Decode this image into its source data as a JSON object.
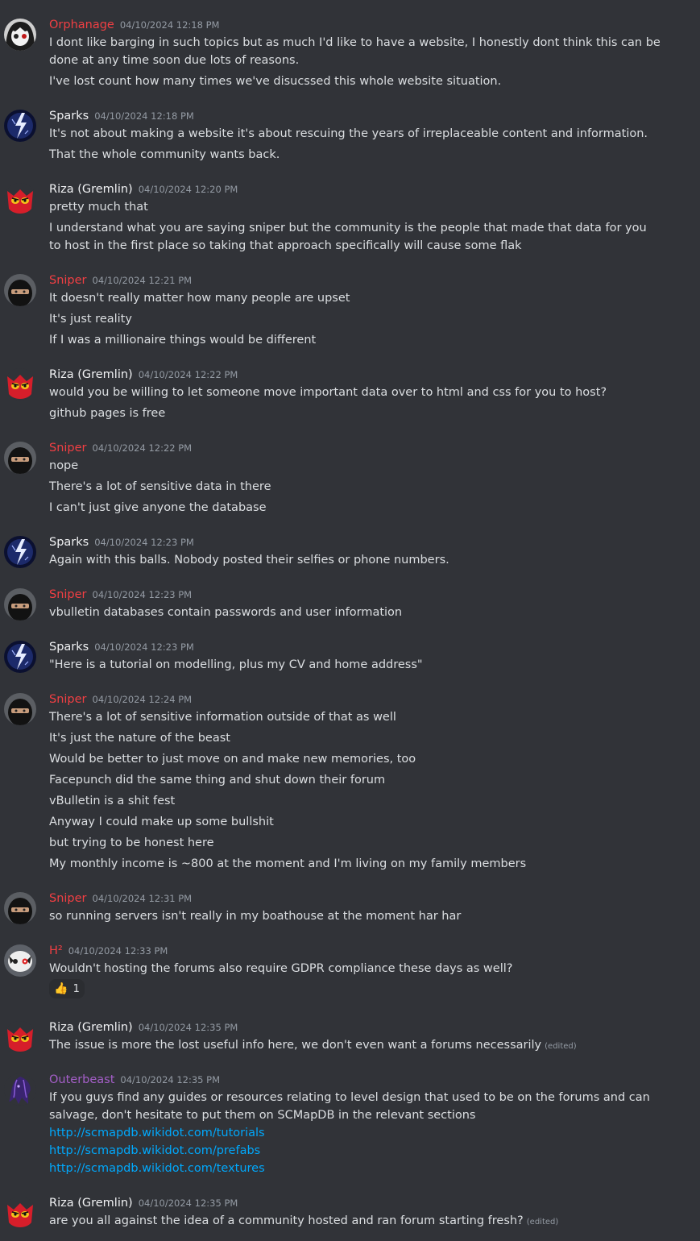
{
  "colors": {
    "background": "#313338",
    "orphanage": "#f23f43",
    "sparks": "#f2f3f5",
    "riza": "#f2f3f5",
    "sniper": "#f23f43",
    "h2": "#f23f43",
    "outerbeast": "#a55fc9",
    "link": "#00a8fc"
  },
  "messages": [
    {
      "author": "Orphanage",
      "time": "04/10/2024 12:18 PM",
      "avatar": "orphanage-avatar",
      "lines": [
        "I dont like barging in such topics but as much I'd like to have a website, I honestly dont think this can be done at any time soon due lots of reasons.",
        "I've lost count how many times we've disucssed this whole website situation."
      ]
    },
    {
      "author": "Sparks",
      "time": "04/10/2024 12:18 PM",
      "avatar": "lightning-avatar",
      "lines": [
        "It's not about making a website it's about rescuing the years of irreplaceable content and information.",
        "That the whole community wants back."
      ]
    },
    {
      "author": "Riza (Gremlin)",
      "time": "04/10/2024 12:20 PM",
      "avatar": "gremlin-avatar",
      "lines": [
        "pretty much that",
        "I understand what you are saying sniper but the community is the people that made that data for you to host in the first place so taking that approach specifically will cause some flak"
      ]
    },
    {
      "author": "Sniper",
      "time": "04/10/2024 12:21 PM",
      "avatar": "ninja-avatar",
      "lines": [
        "It doesn't really matter how many people are upset",
        "It's just reality",
        "If I was a millionaire things would be different"
      ]
    },
    {
      "author": "Riza (Gremlin)",
      "time": "04/10/2024 12:22 PM",
      "avatar": "gremlin-avatar",
      "lines": [
        "would you be willing to let someone move important data over to html and css for you to host?",
        "github pages is free"
      ]
    },
    {
      "author": "Sniper",
      "time": "04/10/2024 12:22 PM",
      "avatar": "ninja-avatar",
      "lines": [
        "nope",
        "There's a lot of sensitive data in there",
        "I can't just give anyone the database"
      ]
    },
    {
      "author": "Sparks",
      "time": "04/10/2024 12:23 PM",
      "avatar": "lightning-avatar",
      "lines": [
        "Again with this balls. Nobody posted their selfies or phone numbers."
      ]
    },
    {
      "author": "Sniper",
      "time": "04/10/2024 12:23 PM",
      "avatar": "ninja-avatar",
      "lines": [
        "vbulletin databases contain passwords and user information"
      ]
    },
    {
      "author": "Sparks",
      "time": "04/10/2024 12:23 PM",
      "avatar": "lightning-avatar",
      "lines": [
        "\"Here is a tutorial on modelling, plus my CV and home address\""
      ]
    },
    {
      "author": "Sniper",
      "time": "04/10/2024 12:24 PM",
      "avatar": "ninja-avatar",
      "lines": [
        "There's a lot of sensitive information outside of that as well",
        "It's just the nature of the beast",
        "Would be better to just move on and make new memories, too",
        "Facepunch did the same thing and shut down their forum",
        "vBulletin is a shit fest",
        "Anyway I could make up some bullshit",
        "but trying to be honest here",
        "My monthly income is ~800 at the moment and I'm living on my family members"
      ]
    },
    {
      "author": "Sniper",
      "time": "04/10/2024 12:31 PM",
      "avatar": "ninja-avatar",
      "lines": [
        "so running servers isn't really in my boathouse at the moment har har"
      ]
    },
    {
      "author": "H²",
      "time": "04/10/2024 12:33 PM",
      "avatar": "h2-avatar",
      "lines": [
        "Wouldn't hosting the forums also require GDPR compliance these days as well?"
      ],
      "reaction": {
        "emoji": "👍",
        "count": "1"
      }
    },
    {
      "author": "Riza (Gremlin)",
      "time": "04/10/2024 12:35 PM",
      "avatar": "gremlin-avatar",
      "lines": [
        "The issue is more the lost useful info here, we don't even want a forums necessarily"
      ],
      "edited": "(edited)"
    },
    {
      "author": "Outerbeast",
      "time": "04/10/2024 12:35 PM",
      "avatar": "outerbeast-avatar",
      "lines": [
        "If you guys find any guides or resources relating to level design that used to be on the forums and can salvage, don't hesitate to put them on SCMapDB in the relevant sections"
      ],
      "links": [
        "http://scmapdb.wikidot.com/tutorials",
        "http://scmapdb.wikidot.com/prefabs",
        "http://scmapdb.wikidot.com/textures"
      ]
    },
    {
      "author": "Riza (Gremlin)",
      "time": "04/10/2024 12:35 PM",
      "avatar": "gremlin-avatar",
      "lines": [
        "are you all against the idea of a community hosted and ran forum starting fresh?"
      ],
      "edited": "(edited)"
    }
  ]
}
